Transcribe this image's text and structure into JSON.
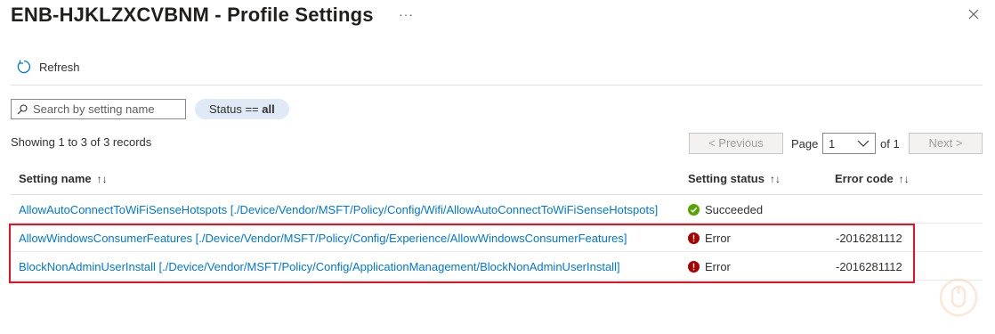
{
  "header": {
    "title": "ENB-HJKLZXCVBNM - Profile Settings",
    "more_label": "···"
  },
  "toolbar": {
    "refresh_label": "Refresh"
  },
  "filters": {
    "search_placeholder": "Search by setting name",
    "status_label": "Status == ",
    "status_value": "all"
  },
  "pagination": {
    "showing": "Showing 1 to 3 of 3 records",
    "previous_label": "< Previous",
    "page_label": "Page",
    "page_value": "1",
    "of_label": "of 1",
    "next_label": "Next >"
  },
  "table": {
    "columns": [
      "Setting name",
      "Setting status",
      "Error code"
    ],
    "rows": [
      {
        "name": "AllowAutoConnectToWiFiSenseHotspots [./Device/Vendor/MSFT/Policy/Config/Wifi/AllowAutoConnectToWiFiSenseHotspots]",
        "status": "Succeeded",
        "status_icon": "check-circle-icon",
        "status_color": "#57a300",
        "error_code": ""
      },
      {
        "name": "AllowWindowsConsumerFeatures [./Device/Vendor/MSFT/Policy/Config/Experience/AllowWindowsConsumerFeatures]",
        "status": "Error",
        "status_icon": "error-circle-icon",
        "status_color": "#a80000",
        "error_code": "-2016281112"
      },
      {
        "name": "BlockNonAdminUserInstall [./Device/Vendor/MSFT/Policy/Config/ApplicationManagement/BlockNonAdminUserInstall]",
        "status": "Error",
        "status_icon": "error-circle-icon",
        "status_color": "#a80000",
        "error_code": "-2016281112"
      }
    ]
  },
  "colors": {
    "accent": "#0078d4",
    "highlight": "#e81123",
    "success": "#57a300",
    "error": "#a80000"
  }
}
